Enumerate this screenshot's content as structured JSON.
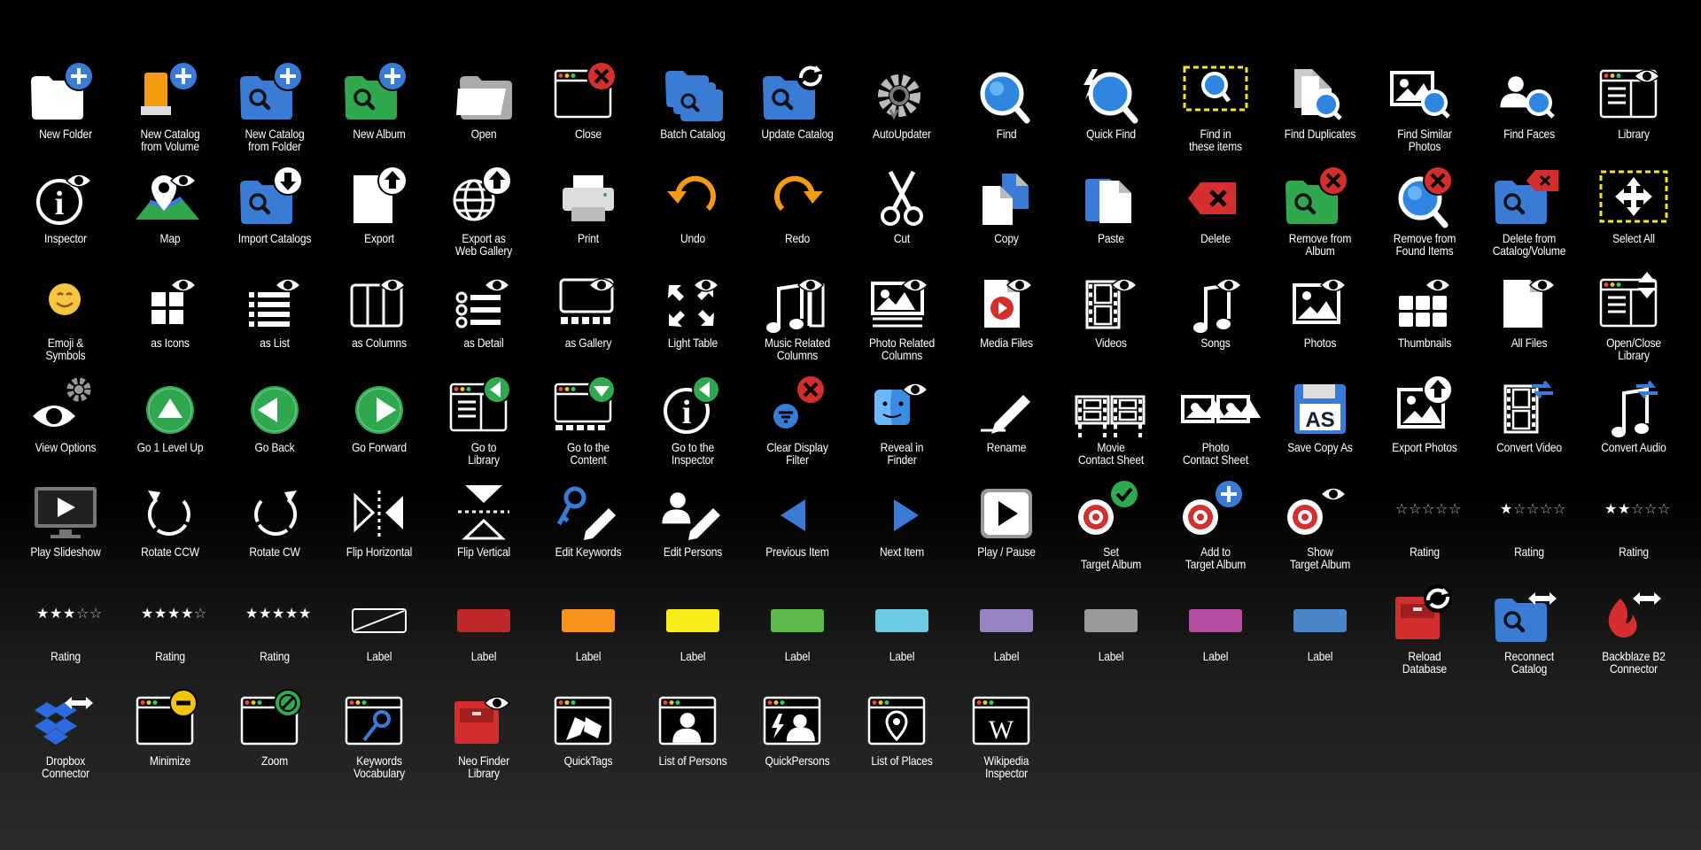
{
  "colors": {
    "blue": "#3a7bd5",
    "green": "#2fa84f",
    "red": "#d32f2f",
    "orange": "#f39c12",
    "white": "#ffffff"
  },
  "items": [
    {
      "label": "New Folder",
      "icon": "new-folder-icon",
      "kind": "folder",
      "badge": "plus"
    },
    {
      "label": "New Catalog\nfrom Volume",
      "icon": "new-catalog-volume-icon",
      "kind": "drive",
      "badge": "plus"
    },
    {
      "label": "New Catalog\nfrom Folder",
      "icon": "new-catalog-folder-icon",
      "kind": "folder-search-blue",
      "badge": "plus"
    },
    {
      "label": "New Album",
      "icon": "new-album-icon",
      "kind": "folder-search-green",
      "badge": "plus"
    },
    {
      "label": "Open",
      "icon": "open-folder-icon",
      "kind": "folder-open"
    },
    {
      "label": "Close",
      "icon": "close-window-icon",
      "kind": "window",
      "badge": "x-red"
    },
    {
      "label": "Batch Catalog",
      "icon": "batch-catalog-icon",
      "kind": "folder-stack"
    },
    {
      "label": "Update Catalog",
      "icon": "update-catalog-icon",
      "kind": "folder-search-blue",
      "badge": "sync"
    },
    {
      "label": "AutoUpdater",
      "icon": "auto-updater-icon",
      "kind": "gear"
    },
    {
      "label": "Find",
      "icon": "find-icon",
      "kind": "magnifier"
    },
    {
      "label": "Quick Find",
      "icon": "quick-find-icon",
      "kind": "magnifier-bolt"
    },
    {
      "label": "Find in\nthese items",
      "icon": "find-in-items-icon",
      "kind": "magnifier-dashed"
    },
    {
      "label": "Find Duplicates",
      "icon": "find-duplicates-icon",
      "kind": "docs-search"
    },
    {
      "label": "Find Similar\nPhotos",
      "icon": "find-similar-photos-icon",
      "kind": "photo-search"
    },
    {
      "label": "Find Faces",
      "icon": "find-faces-icon",
      "kind": "person-search"
    },
    {
      "label": "Library",
      "icon": "library-icon",
      "kind": "window-list",
      "badge": "eye"
    },
    {
      "label": "Inspector",
      "icon": "inspector-icon",
      "kind": "info",
      "badge": "eye"
    },
    {
      "label": "Map",
      "icon": "map-icon",
      "kind": "map",
      "badge": "eye"
    },
    {
      "label": "Import Catalogs",
      "icon": "import-catalogs-icon",
      "kind": "folder-search-blue",
      "badge": "down"
    },
    {
      "label": "Export",
      "icon": "export-icon",
      "kind": "doc",
      "badge": "up"
    },
    {
      "label": "Export as\nWeb Gallery",
      "icon": "export-web-gallery-icon",
      "kind": "globe",
      "badge": "up"
    },
    {
      "label": "Print",
      "icon": "print-icon",
      "kind": "printer"
    },
    {
      "label": "Undo",
      "icon": "undo-icon",
      "kind": "undo"
    },
    {
      "label": "Redo",
      "icon": "redo-icon",
      "kind": "redo"
    },
    {
      "label": "Cut",
      "icon": "scissors-icon",
      "kind": "scissors"
    },
    {
      "label": "Copy",
      "icon": "copy-icon",
      "kind": "copy"
    },
    {
      "label": "Paste",
      "icon": "paste-icon",
      "kind": "paste"
    },
    {
      "label": "Delete",
      "icon": "delete-icon",
      "kind": "delete-key"
    },
    {
      "label": "Remove from\nAlbum",
      "icon": "remove-from-album-icon",
      "kind": "folder-search-green",
      "badge": "x-red"
    },
    {
      "label": "Remove from\nFound Items",
      "icon": "remove-found-icon",
      "kind": "magnifier",
      "badge": "x-red"
    },
    {
      "label": "Delete from\nCatalog/Volume",
      "icon": "delete-catalog-icon",
      "kind": "folder-search-blue",
      "badge": "delete-key"
    },
    {
      "label": "Select All",
      "icon": "select-all-icon",
      "kind": "move-dashed"
    },
    {
      "label": "Emoji &\nSymbols",
      "icon": "emoji-icon",
      "kind": "emoji"
    },
    {
      "label": "as Icons",
      "icon": "view-icons-icon",
      "kind": "grid4",
      "badge": "eye"
    },
    {
      "label": "as List",
      "icon": "view-list-icon",
      "kind": "list",
      "badge": "eye"
    },
    {
      "label": "as Columns",
      "icon": "view-columns-icon",
      "kind": "columns",
      "badge": "eye"
    },
    {
      "label": "as Detail",
      "icon": "view-detail-icon",
      "kind": "detail",
      "badge": "eye"
    },
    {
      "label": "as Gallery",
      "icon": "view-gallery-icon",
      "kind": "gallery",
      "badge": "eye"
    },
    {
      "label": "Light Table",
      "icon": "light-table-icon",
      "kind": "arrows-out",
      "badge": "eye"
    },
    {
      "label": "Music Related\nColumns",
      "icon": "music-columns-icon",
      "kind": "music-columns",
      "badge": "eye"
    },
    {
      "label": "Photo Related\nColumns",
      "icon": "photo-columns-icon",
      "kind": "photo-columns",
      "badge": "eye"
    },
    {
      "label": "Media Files",
      "icon": "media-files-icon",
      "kind": "media-doc",
      "badge": "eye"
    },
    {
      "label": "Videos",
      "icon": "videos-icon",
      "kind": "film",
      "badge": "eye"
    },
    {
      "label": "Songs",
      "icon": "songs-icon",
      "kind": "note",
      "badge": "eye"
    },
    {
      "label": "Photos",
      "icon": "photos-icon",
      "kind": "photo",
      "badge": "eye"
    },
    {
      "label": "Thumbnails",
      "icon": "thumbnails-icon",
      "kind": "grid6",
      "badge": "eye"
    },
    {
      "label": "All Files",
      "icon": "all-files-icon",
      "kind": "doc",
      "badge": "eye"
    },
    {
      "label": "Open/Close\nLibrary",
      "icon": "open-close-library-icon",
      "kind": "window-list",
      "badge": "updown"
    },
    {
      "label": "View Options",
      "icon": "view-options-icon",
      "kind": "eye-big",
      "badge": "gear"
    },
    {
      "label": "Go 1 Level Up",
      "icon": "go-up-icon",
      "kind": "circle-up"
    },
    {
      "label": "Go Back",
      "icon": "go-back-icon",
      "kind": "circle-left"
    },
    {
      "label": "Go Forward",
      "icon": "go-forward-icon",
      "kind": "circle-right"
    },
    {
      "label": "Go to\nLibrary",
      "icon": "go-library-icon",
      "kind": "window-list",
      "badge": "green-left"
    },
    {
      "label": "Go to the\nContent",
      "icon": "go-content-icon",
      "kind": "window-gallery",
      "badge": "green-down"
    },
    {
      "label": "Go to the\nInspector",
      "icon": "go-inspector-icon",
      "kind": "info",
      "badge": "green-left"
    },
    {
      "label": "Clear Display\nFilter",
      "icon": "clear-filter-icon",
      "kind": "filter",
      "badge": "x-red"
    },
    {
      "label": "Reveal in\nFinder",
      "icon": "finder-icon",
      "kind": "finder",
      "badge": "eye"
    },
    {
      "label": "Rename",
      "icon": "rename-icon",
      "kind": "pencil-line"
    },
    {
      "label": "Movie\nContact Sheet",
      "icon": "movie-sheet-icon",
      "kind": "film2"
    },
    {
      "label": "Photo\nContact Sheet",
      "icon": "photo-sheet-icon",
      "kind": "photo2"
    },
    {
      "label": "Save Copy As",
      "icon": "save-copy-icon",
      "kind": "floppy"
    },
    {
      "label": "Export Photos",
      "icon": "export-photos-icon",
      "kind": "photo",
      "badge": "up"
    },
    {
      "label": "Convert Video",
      "icon": "convert-video-icon",
      "kind": "film",
      "badge": "convert"
    },
    {
      "label": "Convert Audio",
      "icon": "convert-audio-icon",
      "kind": "note",
      "badge": "convert"
    },
    {
      "label": "Play Slideshow",
      "icon": "slideshow-icon",
      "kind": "monitor"
    },
    {
      "label": "Rotate CCW",
      "icon": "rotate-ccw-icon",
      "kind": "rotate-ccw"
    },
    {
      "label": "Rotate CW",
      "icon": "rotate-cw-icon",
      "kind": "rotate-cw"
    },
    {
      "label": "Flip Horizontal",
      "icon": "flip-h-icon",
      "kind": "flip-h"
    },
    {
      "label": "Flip Vertical",
      "icon": "flip-v-icon",
      "kind": "flip-v"
    },
    {
      "label": "Edit Keywords",
      "icon": "edit-keywords-icon",
      "kind": "key-pencil"
    },
    {
      "label": "Edit Persons",
      "icon": "edit-persons-icon",
      "kind": "person-pencil"
    },
    {
      "label": "Previous Item",
      "icon": "previous-icon",
      "kind": "tri-left"
    },
    {
      "label": "Next Item",
      "icon": "next-icon",
      "kind": "tri-right"
    },
    {
      "label": "Play / Pause",
      "icon": "play-pause-icon",
      "kind": "play-button"
    },
    {
      "label": "Set\nTarget Album",
      "icon": "set-target-icon",
      "kind": "target",
      "badge": "check-green"
    },
    {
      "label": "Add to\nTarget Album",
      "icon": "add-target-icon",
      "kind": "target",
      "badge": "plus"
    },
    {
      "label": "Show\nTarget Album",
      "icon": "show-target-icon",
      "kind": "target",
      "badge": "eye"
    },
    {
      "label": "Rating",
      "icon": "rating-icon",
      "kind": "stars",
      "stars": 0
    },
    {
      "label": "Rating",
      "icon": "rating-icon",
      "kind": "stars",
      "stars": 1
    },
    {
      "label": "Rating",
      "icon": "rating-icon",
      "kind": "stars",
      "stars": 2
    },
    {
      "label": "Rating",
      "icon": "rating-icon",
      "kind": "stars",
      "stars": 3
    },
    {
      "label": "Rating",
      "icon": "rating-icon",
      "kind": "stars",
      "stars": 4
    },
    {
      "label": "Rating",
      "icon": "rating-icon",
      "kind": "stars",
      "stars": 5
    },
    {
      "label": "Label",
      "icon": "label-none-icon",
      "kind": "label-none"
    },
    {
      "label": "Label",
      "icon": "label-red-icon",
      "kind": "label",
      "color": "#c0282a"
    },
    {
      "label": "Label",
      "icon": "label-orange-icon",
      "kind": "label",
      "color": "#f7931e"
    },
    {
      "label": "Label",
      "icon": "label-yellow-icon",
      "kind": "label",
      "color": "#f9ec1b"
    },
    {
      "label": "Label",
      "icon": "label-green-icon",
      "kind": "label",
      "color": "#5cb947"
    },
    {
      "label": "Label",
      "icon": "label-cyan-icon",
      "kind": "label",
      "color": "#6ccbe0"
    },
    {
      "label": "Label",
      "icon": "label-purple-icon",
      "kind": "label",
      "color": "#9784c3"
    },
    {
      "label": "Label",
      "icon": "label-gray-icon",
      "kind": "label",
      "color": "#9a9a9a"
    },
    {
      "label": "Label",
      "icon": "label-magenta-icon",
      "kind": "label",
      "color": "#b44fa4"
    },
    {
      "label": "Label",
      "icon": "label-blue-icon",
      "kind": "label",
      "color": "#4a86c8"
    },
    {
      "label": "Reload\nDatabase",
      "icon": "reload-database-icon",
      "kind": "cabinet",
      "badge": "sync"
    },
    {
      "label": "Reconnect\nCatalog",
      "icon": "reconnect-catalog-icon",
      "kind": "folder-search-blue",
      "badge": "lr"
    },
    {
      "label": "Backblaze B2\nConnector",
      "icon": "backblaze-icon",
      "kind": "flame",
      "badge": "lr"
    },
    {
      "label": "Dropbox\nConnector",
      "icon": "dropbox-icon",
      "kind": "dropbox",
      "badge": "lr"
    },
    {
      "label": "Minimize",
      "icon": "minimize-icon",
      "kind": "window",
      "badge": "minus-yellow"
    },
    {
      "label": "Zoom",
      "icon": "zoom-icon",
      "kind": "window",
      "badge": "zoom-green"
    },
    {
      "label": "Keywords\nVocabulary",
      "icon": "keywords-vocab-icon",
      "kind": "window-key"
    },
    {
      "label": "Neo Finder\nLibrary",
      "icon": "neofinder-library-icon",
      "kind": "cabinet",
      "badge": "eye"
    },
    {
      "label": "QuickTags",
      "icon": "quicktags-icon",
      "kind": "window-tags"
    },
    {
      "label": "List of Persons",
      "icon": "list-persons-icon",
      "kind": "window-person"
    },
    {
      "label": "QuickPersons",
      "icon": "quickpersons-icon",
      "kind": "window-persons"
    },
    {
      "label": "List of Places",
      "icon": "list-places-icon",
      "kind": "window-pin"
    },
    {
      "label": "Wikipedia\nInspector",
      "icon": "wikipedia-icon",
      "kind": "window-w"
    }
  ]
}
